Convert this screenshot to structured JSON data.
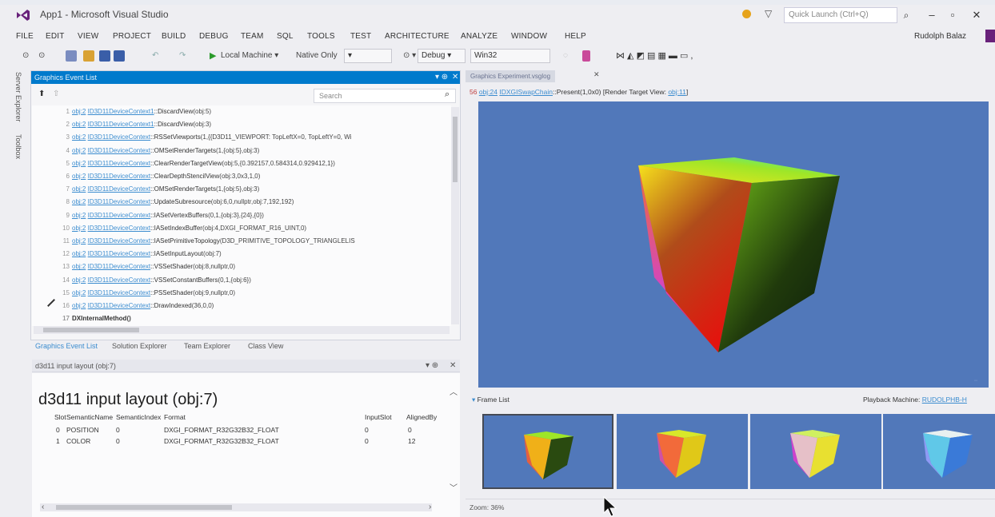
{
  "window": {
    "title": "App1 - Microsoft Visual Studio",
    "quick_launch_placeholder": "Quick Launch (Ctrl+Q)",
    "user": "Rudolph Balaz"
  },
  "menu": [
    "FILE",
    "EDIT",
    "VIEW",
    "PROJECT",
    "BUILD",
    "DEBUG",
    "TEAM",
    "SQL",
    "TOOLS",
    "TEST",
    "ARCHITECTURE",
    "ANALYZE",
    "WINDOW",
    "HELP"
  ],
  "toolbar": {
    "run_target": "Local Machine",
    "debugger": "Native Only",
    "configuration": "Debug",
    "platform": "Win32"
  },
  "side_tabs": [
    "Server Explorer",
    "Toolbox"
  ],
  "event_list": {
    "title": "Graphics Event List",
    "search_placeholder": "Search",
    "rows": [
      {
        "num": "1",
        "obj": "obj:2",
        "ctx": "ID3D11DeviceContext1",
        "method": "DiscardView",
        "args": "(obj:5)"
      },
      {
        "num": "2",
        "obj": "obj:2",
        "ctx": "ID3D11DeviceContext1",
        "method": "DiscardView",
        "args": "(obj:3)"
      },
      {
        "num": "3",
        "obj": "obj:2",
        "ctx": "ID3D11DeviceContext",
        "method": "RSSetViewports",
        "args": "(1,{{D3D11_VIEWPORT: TopLeftX=0, TopLeftY=0, Wi"
      },
      {
        "num": "4",
        "obj": "obj:2",
        "ctx": "ID3D11DeviceContext",
        "method": "OMSetRenderTargets",
        "args": "(1,{obj:5},obj:3)"
      },
      {
        "num": "5",
        "obj": "obj:2",
        "ctx": "ID3D11DeviceContext",
        "method": "ClearRenderTargetView",
        "args": "(obj:5,{0.392157,0.584314,0.929412,1})"
      },
      {
        "num": "6",
        "obj": "obj:2",
        "ctx": "ID3D11DeviceContext",
        "method": "ClearDepthStencilView",
        "args": "(obj:3,0x3,1,0)"
      },
      {
        "num": "7",
        "obj": "obj:2",
        "ctx": "ID3D11DeviceContext",
        "method": "OMSetRenderTargets",
        "args": "(1,{obj:5},obj:3)"
      },
      {
        "num": "8",
        "obj": "obj:2",
        "ctx": "ID3D11DeviceContext",
        "method": "UpdateSubresource",
        "args": "(obj:6,0,nullptr,obj:7,192,192)"
      },
      {
        "num": "9",
        "obj": "obj:2",
        "ctx": "ID3D11DeviceContext",
        "method": "IASetVertexBuffers",
        "args": "(0,1,{obj:3},{24},{0})"
      },
      {
        "num": "10",
        "obj": "obj:2",
        "ctx": "ID3D11DeviceContext",
        "method": "IASetIndexBuffer",
        "args": "(obj:4,DXGI_FORMAT_R16_UINT,0)"
      },
      {
        "num": "11",
        "obj": "obj:2",
        "ctx": "ID3D11DeviceContext",
        "method": "IASetPrimitiveTopology",
        "args": "(D3D_PRIMITIVE_TOPOLOGY_TRIANGLELIS"
      },
      {
        "num": "12",
        "obj": "obj:2",
        "ctx": "ID3D11DeviceContext",
        "method": "IASetInputLayout",
        "args": "(obj:7)"
      },
      {
        "num": "13",
        "obj": "obj:2",
        "ctx": "ID3D11DeviceContext",
        "method": "VSSetShader",
        "args": "(obj:8,nullptr,0)"
      },
      {
        "num": "14",
        "obj": "obj:2",
        "ctx": "ID3D11DeviceContext",
        "method": "VSSetConstantBuffers",
        "args": "(0,1,{obj:6})"
      },
      {
        "num": "15",
        "obj": "obj:2",
        "ctx": "ID3D11DeviceContext",
        "method": "PSSetShader",
        "args": "(obj:9,nullptr,0)"
      },
      {
        "num": "16",
        "obj": "obj:2",
        "ctx": "ID3D11DeviceContext",
        "method": "DrawIndexed",
        "args": "(36,0,0)"
      },
      {
        "num": "17",
        "obj": "",
        "ctx": "",
        "method": "DXInternalMethod",
        "args": "()"
      }
    ]
  },
  "bottom_tabs": [
    "Graphics Event List",
    "Solution Explorer",
    "Team Explorer",
    "Class View"
  ],
  "layout_panel": {
    "tab_title": "d3d11 input layout (obj:7)",
    "heading": "d3d11 input layout (obj:7)",
    "columns": [
      "Slot",
      "SemanticName",
      "SemanticIndex",
      "Format",
      "InputSlot",
      "AlignedBy"
    ],
    "rows": [
      [
        "0",
        "POSITION",
        "0",
        "DXGI_FORMAT_R32G32B32_FLOAT",
        "0",
        "0"
      ],
      [
        "1",
        "COLOR",
        "0",
        "DXGI_FORMAT_R32G32B32_FLOAT",
        "0",
        "12"
      ]
    ]
  },
  "graphics": {
    "tab_title": "Graphics Experiment.vsglog",
    "present_num": "56",
    "present_obj": "obj:24",
    "present_ctx": "IDXGISwapChain",
    "present_method": "Present(1,0x0)",
    "present_rt_label": "[Render Target View:",
    "present_rt_obj": "obj:11",
    "present_rt_close": "]",
    "frame_list_label": "Frame List",
    "playback_label": "Playback Machine:",
    "playback_machine": "RUDOLPHB-H",
    "zoom": "Zoom: 36%",
    "clear_color": "#5178ba",
    "frame_count": 4
  }
}
